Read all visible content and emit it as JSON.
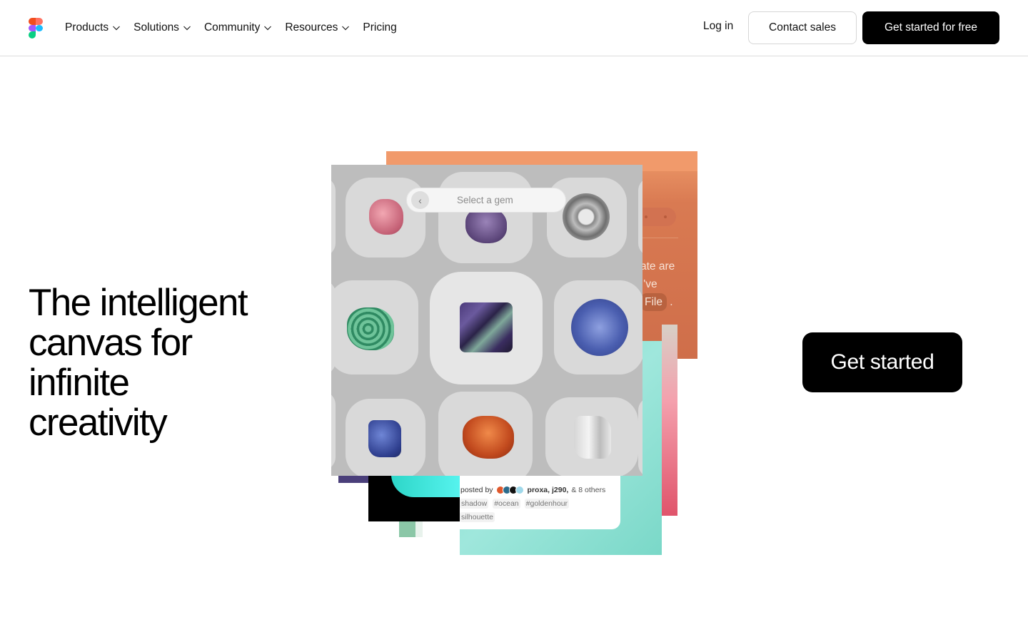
{
  "nav": {
    "items": [
      {
        "label": "Products",
        "has_dropdown": true
      },
      {
        "label": "Solutions",
        "has_dropdown": true
      },
      {
        "label": "Community",
        "has_dropdown": true
      },
      {
        "label": "Resources",
        "has_dropdown": true
      },
      {
        "label": "Pricing",
        "has_dropdown": false
      }
    ],
    "login": "Log in",
    "contact_sales": "Contact sales",
    "get_started_free": "Get started for free"
  },
  "hero": {
    "headline_lines": [
      "The intelligent",
      "canvas for",
      "infinite",
      "creativity"
    ],
    "cta": "Get started"
  },
  "collage": {
    "gem_search_placeholder": "Select a gem",
    "orange_text_lines": [
      "ate are",
      "I've"
    ],
    "orange_file_chip": "File",
    "orange_trailing": ".",
    "posted_by_prefix": "posted by",
    "posted_users": "proxa,  j290,",
    "posted_others": "& 8 others",
    "tags": [
      "shadow",
      "#ocean",
      "#goldenhour"
    ],
    "tag_extra": "silhouette"
  },
  "colors": {
    "accent_dark": "#000000",
    "border": "#dcdcdc",
    "logo": [
      "#f24e1e",
      "#ff7262",
      "#a259ff",
      "#1abcfe",
      "#0acf83"
    ]
  }
}
